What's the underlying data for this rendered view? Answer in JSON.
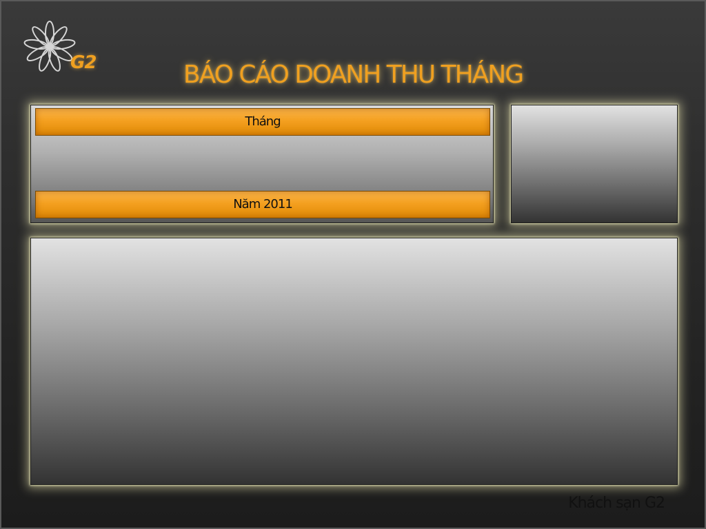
{
  "header": {
    "logo_text": "G2",
    "logo_icon": "flower-icon",
    "title": "BÁO CÁO DOANH THU THÁNG"
  },
  "filters": {
    "month_label": "Tháng",
    "year_label": "Năm 2011"
  },
  "footer": {
    "hotel_name": "Khách sạn G2"
  },
  "colors": {
    "accent": "#f0a020",
    "background": "#2a2a2a",
    "panel_glow": "#fffac0"
  }
}
